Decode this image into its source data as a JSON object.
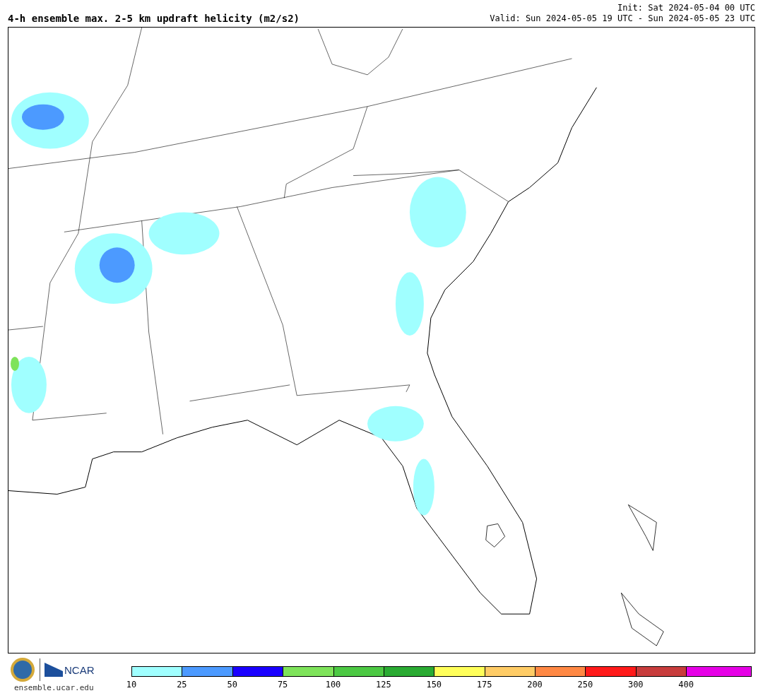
{
  "title": "4-h ensemble max. 2-5 km updraft helicity (m2/s2)",
  "init": "Init: Sat 2024-05-04 00 UTC",
  "valid": "Valid: Sun 2024-05-05 19 UTC - Sun 2024-05-05 23 UTC",
  "footer": {
    "logo_text": "NCAR",
    "site": "ensemble.ucar.edu"
  },
  "colorbar": [
    {
      "color": "#a0ffff",
      "label": "10"
    },
    {
      "color": "#4c9aff",
      "label": "25"
    },
    {
      "color": "#1a00ff",
      "label": "50"
    },
    {
      "color": "#7ee35a",
      "label": "75"
    },
    {
      "color": "#4cc943",
      "label": "100"
    },
    {
      "color": "#2aab32",
      "label": "125"
    },
    {
      "color": "#ffff5a",
      "label": "150"
    },
    {
      "color": "#ffcc66",
      "label": "175"
    },
    {
      "color": "#ff8844",
      "label": "200"
    },
    {
      "color": "#ff1a1a",
      "label": "250"
    },
    {
      "color": "#c83c3c",
      "label": "300"
    },
    {
      "color": "#e600e6",
      "label": "400"
    }
  ]
}
